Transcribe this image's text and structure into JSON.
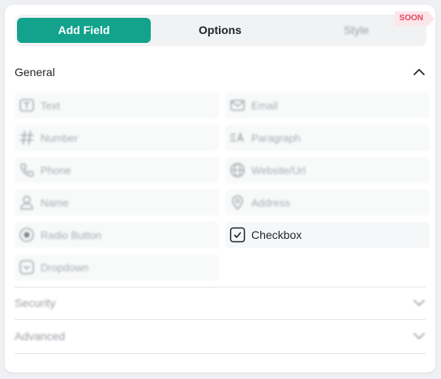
{
  "tabs": {
    "add_field": "Add Field",
    "options": "Options",
    "style": "Style",
    "style_badge": "SOON"
  },
  "sections": {
    "general": "General",
    "security": "Security",
    "advanced": "Advanced"
  },
  "fields": [
    {
      "label": "Text",
      "icon": "text-icon"
    },
    {
      "label": "Email",
      "icon": "email-icon"
    },
    {
      "label": "Number",
      "icon": "hash-icon"
    },
    {
      "label": "Paragraph",
      "icon": "paragraph-icon"
    },
    {
      "label": "Phone",
      "icon": "phone-icon"
    },
    {
      "label": "Website/Url",
      "icon": "globe-icon"
    },
    {
      "label": "Name",
      "icon": "user-icon"
    },
    {
      "label": "Address",
      "icon": "location-icon"
    },
    {
      "label": "Radio Button",
      "icon": "radio-icon"
    },
    {
      "label": "Checkbox",
      "icon": "checkbox-icon"
    },
    {
      "label": "Dropdown",
      "icon": "dropdown-icon"
    }
  ],
  "colors": {
    "accent": "#13a38c",
    "badge_text": "#e0485f",
    "badge_bg": "#fde6ea"
  }
}
